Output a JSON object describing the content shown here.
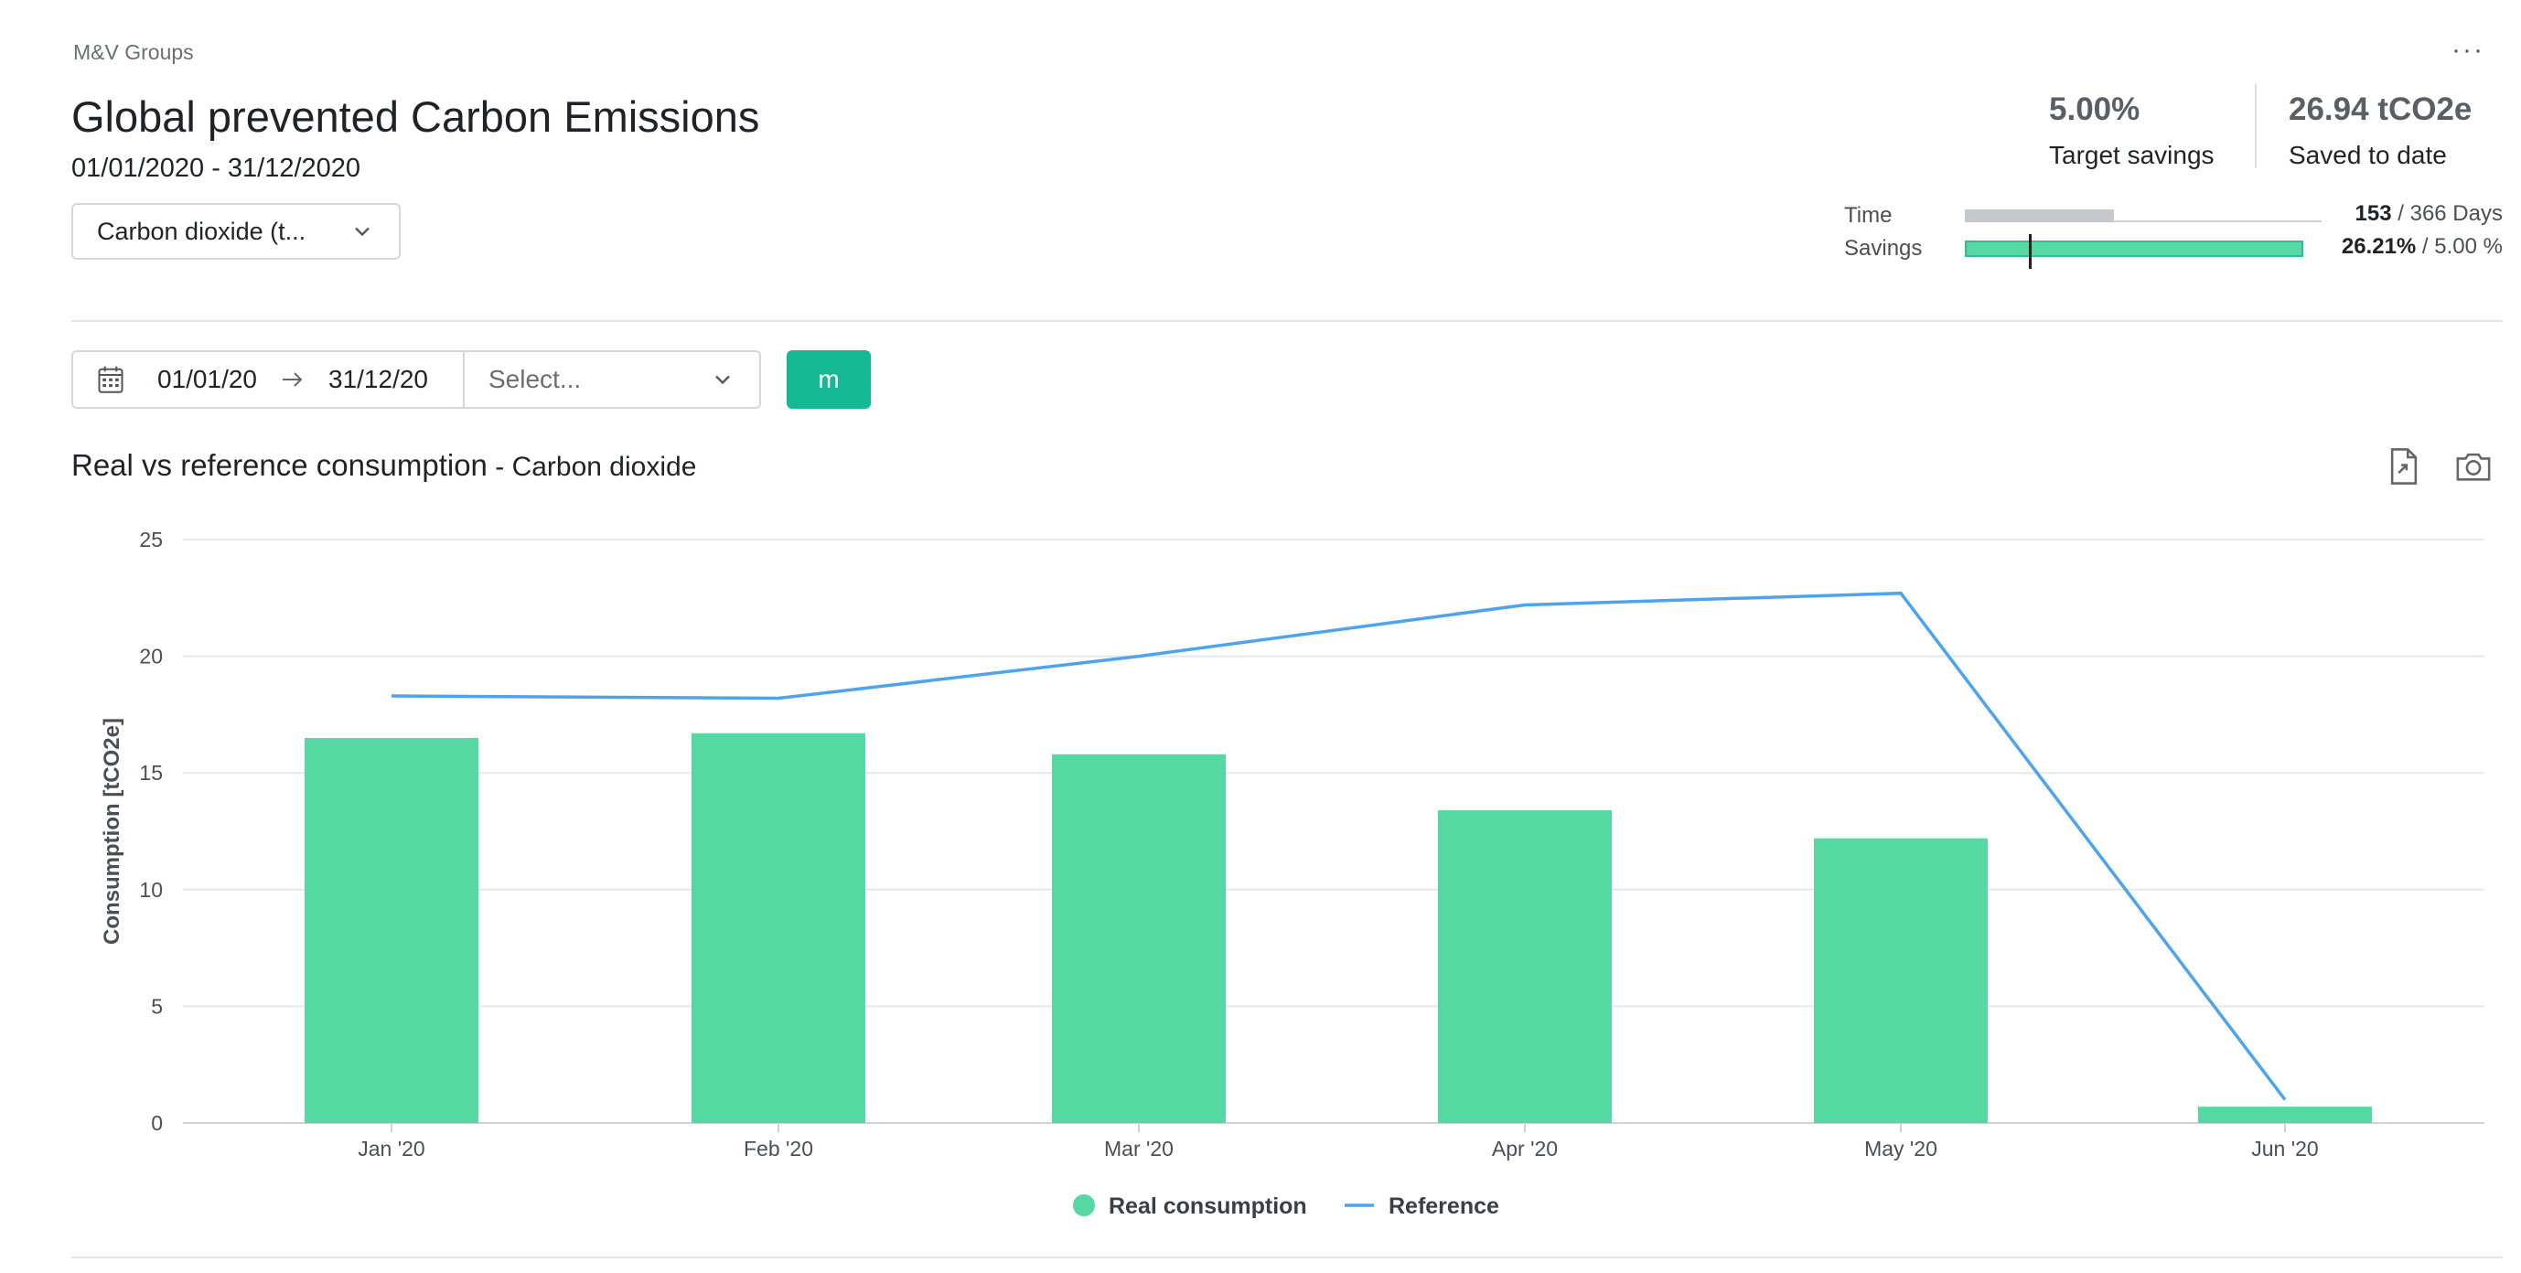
{
  "breadcrumb": "M&V Groups",
  "more_menu": "···",
  "title": "Global prevented Carbon Emissions",
  "period": "01/01/2020 - 31/12/2020",
  "unit_select": {
    "value": "Carbon dioxide (t..."
  },
  "kpis": {
    "target": {
      "value": "5.00%",
      "label": "Target savings"
    },
    "saved": {
      "value": "26.94 tCO2e",
      "label": "Saved to date"
    }
  },
  "progress": {
    "time": {
      "label": "Time",
      "current": "153",
      "total": " / 366 Days",
      "fraction": 0.418
    },
    "savings": {
      "label": "Savings",
      "current": "26.21%",
      "total": " / 5.00 %",
      "target_fraction": 0.19
    }
  },
  "filters": {
    "start_date": "01/01/20",
    "end_date": "31/12/20",
    "select_placeholder": "Select...",
    "granularity_button": "m"
  },
  "chart_header": {
    "title": "Real vs reference consumption",
    "separator": " - ",
    "subtitle": "Carbon dioxide"
  },
  "colors": {
    "bar": "#55d8a2",
    "line": "#4da3ec",
    "accent": "#14b894"
  },
  "chart_data": {
    "type": "bar",
    "categories": [
      "Jan '20",
      "Feb '20",
      "Mar '20",
      "Apr '20",
      "May '20",
      "Jun '20"
    ],
    "series": [
      {
        "name": "Real consumption",
        "type": "bar",
        "values": [
          16.5,
          16.7,
          15.8,
          13.4,
          12.2,
          0.7
        ]
      },
      {
        "name": "Reference",
        "type": "line",
        "values": [
          18.3,
          18.2,
          20.0,
          22.2,
          22.7,
          1.0
        ]
      }
    ],
    "ylabel": "Consumption [tCO2e]",
    "xlabel": "",
    "ylim": [
      0,
      25
    ],
    "yticks": [
      0,
      5,
      10,
      15,
      20,
      25
    ],
    "grid": true,
    "legend": "bottom-center"
  }
}
